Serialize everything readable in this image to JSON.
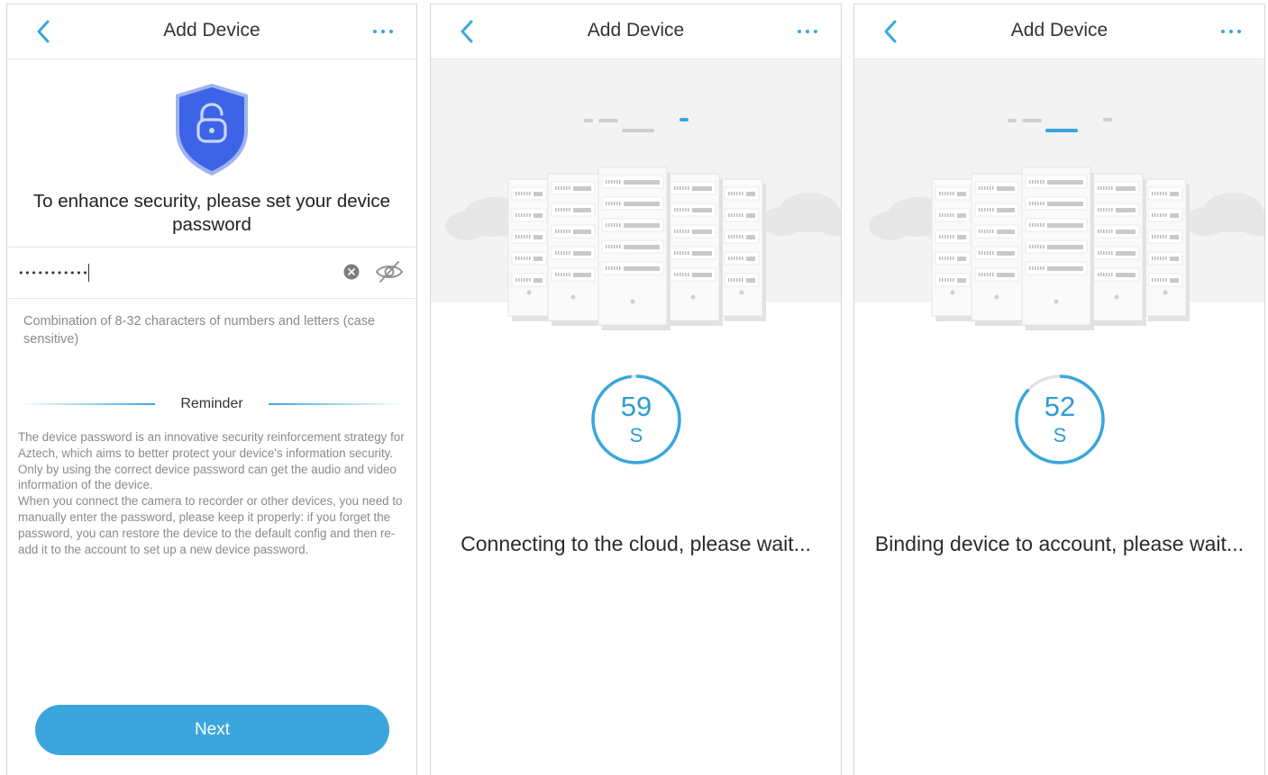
{
  "colors": {
    "accent": "#3aa6dd",
    "shield": "#3d64e6",
    "text": "#333333",
    "muted": "#8a8a8a"
  },
  "panel1": {
    "header": {
      "title": "Add Device",
      "back_icon": "chevron-left-icon",
      "more_icon": "ellipsis-icon"
    },
    "headline": "To enhance security, please set your device password",
    "password": {
      "value": "•••••••••••"
    },
    "hint": "Combination of 8-32 characters of numbers and letters (case sensitive)",
    "reminder_label": "Reminder",
    "reminder_text": "The device password is an innovative security reinforcement strategy for Aztech, which aims to better protect your device's information security. Only by using the correct device password can get the audio and video information of the device.\n When you connect the camera to recorder or other devices, you need to manually enter the password, please keep it properly: if you forget the password, you can restore the device to the default config and then re-add it to the account to set up a new device password.",
    "next_label": "Next"
  },
  "panel2": {
    "header": {
      "title": "Add Device"
    },
    "countdown": {
      "value": "59",
      "unit": "S",
      "progress": 0.98
    },
    "status": "Connecting to the cloud, please wait..."
  },
  "panel3": {
    "header": {
      "title": "Add Device"
    },
    "countdown": {
      "value": "52",
      "unit": "S",
      "progress": 0.87
    },
    "status": "Binding device to account, please wait..."
  }
}
